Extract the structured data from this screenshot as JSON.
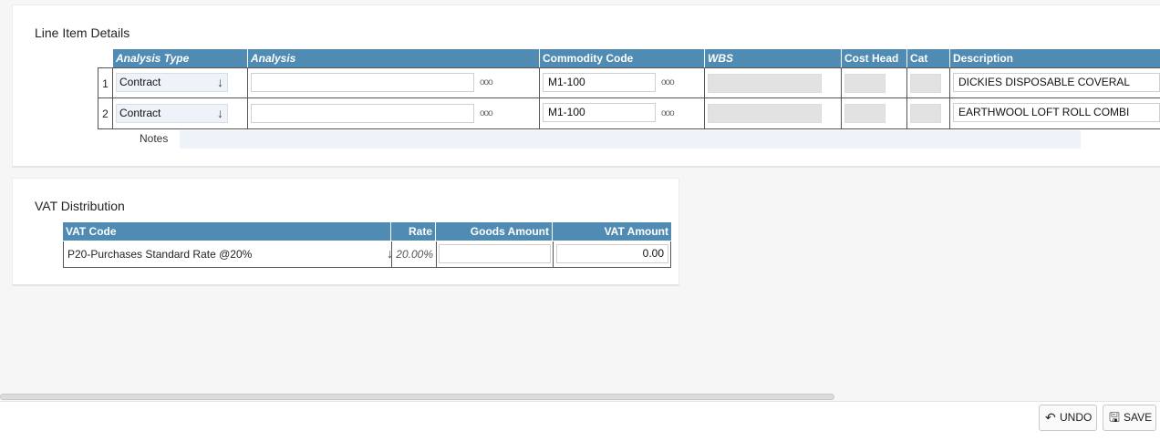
{
  "line_items": {
    "title": "Line Item Details",
    "columns": {
      "analysis_type": "Analysis Type",
      "analysis": "Analysis",
      "commodity_code": "Commodity Code",
      "wbs": "WBS",
      "cost_head": "Cost Head",
      "cat": "Cat",
      "description": "Description"
    },
    "rows": [
      {
        "num": "1",
        "analysis_type": "Contract",
        "analysis": "",
        "commodity_code": "M1-100",
        "description": "DICKIES DISPOSABLE COVERAL"
      },
      {
        "num": "2",
        "analysis_type": "Contract",
        "analysis": "",
        "commodity_code": "M1-100",
        "description": "EARTHWOOL LOFT ROLL COMBI"
      }
    ],
    "lookup_glyph": "ooo",
    "dropdown_glyph": "↓",
    "notes_label": "Notes"
  },
  "vat": {
    "title": "VAT Distribution",
    "columns": {
      "vat_code": "VAT Code",
      "rate": "Rate",
      "goods_amount": "Goods Amount",
      "vat_amount": "VAT Amount"
    },
    "row": {
      "vat_code": "P20-Purchases Standard Rate @20%",
      "rate": "20.00%",
      "goods_amount": "",
      "vat_amount": "0.00"
    }
  },
  "footer": {
    "undo_label": "UNDO",
    "save_label": "SAVE",
    "undo_icon": "↶",
    "save_icon": "🖫"
  },
  "colors": {
    "header_bg": "#4f8bb3",
    "select_bg": "#eef3fa",
    "disabled_bg": "#e2e2e2"
  }
}
